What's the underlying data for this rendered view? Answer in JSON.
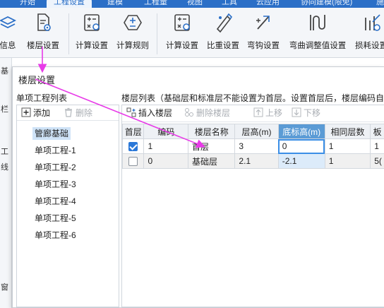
{
  "menu_tabs": [
    "开始",
    "工程设置",
    "建模",
    "工程量",
    "视图",
    "工具",
    "云应用",
    "协同建模(限免)",
    "施"
  ],
  "active_tab_index": 1,
  "ribbon": {
    "buttons": [
      {
        "label": "信息",
        "icon": "info-layers-icon"
      },
      {
        "label": "楼层设置",
        "icon": "floor-settings-icon"
      },
      {
        "label": "计算设置",
        "icon": "calc-settings-icon"
      },
      {
        "label": "计算规则",
        "icon": "calc-rules-icon"
      },
      {
        "label": "计算设置",
        "icon": "calc-settings-icon"
      },
      {
        "label": "比重设置",
        "icon": "density-settings-icon"
      },
      {
        "label": "弯钩设置",
        "icon": "hook-settings-icon"
      },
      {
        "label": "弯曲调整值设置",
        "icon": "bend-adjust-icon"
      },
      {
        "label": "损耗设置",
        "icon": "loss-settings-icon"
      }
    ]
  },
  "left_strip_text": [
    "基",
    "栏",
    "工",
    "线",
    "窗"
  ],
  "dialog": {
    "title": "楼层设置",
    "left_pane": {
      "header": "单项工程列表",
      "add_label": "添加",
      "delete_label": "删除",
      "items": [
        "管廊基础",
        "单项工程-1",
        "单项工程-2",
        "单项工程-3",
        "单项工程-4",
        "单项工程-5",
        "单项工程-6"
      ],
      "selected_index": 0
    },
    "right_pane": {
      "header": "楼层列表（基础层和标准层不能设置为首层。设置首层后，楼层编码自",
      "insert_label": "插入楼层",
      "delete_label": "删除楼层",
      "up_label": "上移",
      "down_label": "下移",
      "columns": [
        "首层",
        "编码",
        "楼层名称",
        "层高(m)",
        "底标高(m)",
        "相同层数",
        "板"
      ],
      "highlight_column": 4,
      "rows": [
        {
          "first": true,
          "code": "1",
          "name": "首层",
          "height": "3",
          "bottom": "0",
          "same": "1",
          "slab": "1"
        },
        {
          "first": false,
          "code": "0",
          "name": "基础层",
          "height": "2.1",
          "bottom": "-2.1",
          "same": "1",
          "slab": "5("
        }
      ]
    }
  },
  "colors": {
    "accent": "#2b6fc7",
    "annotation_arrow": "#e83be8",
    "header_highlight": "#5b9bd5"
  }
}
